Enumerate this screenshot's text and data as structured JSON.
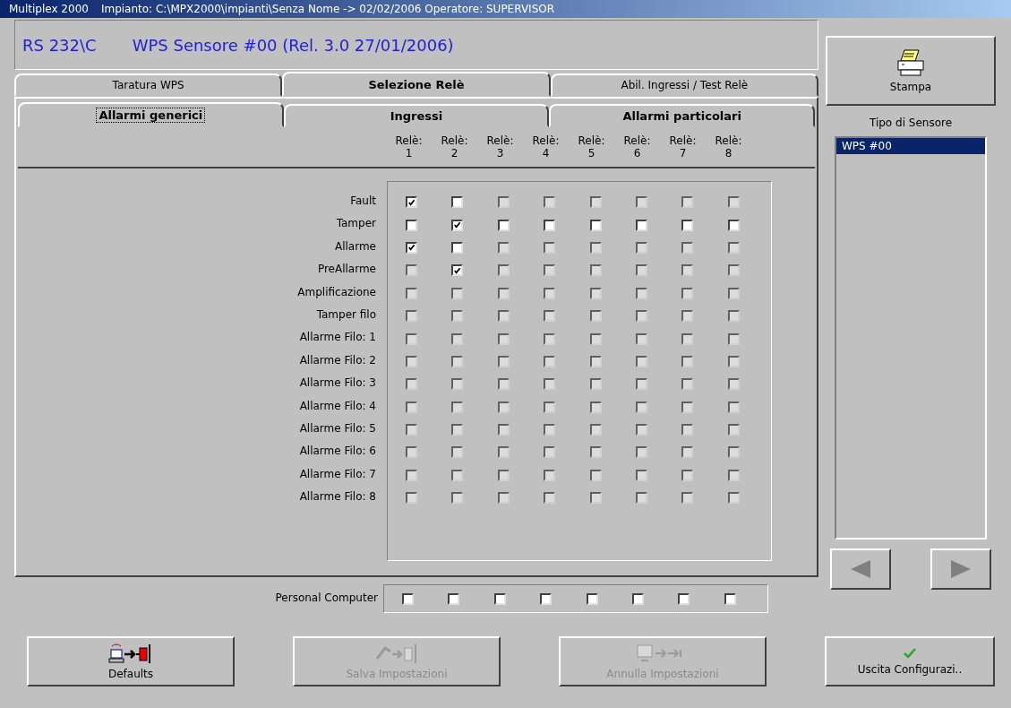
{
  "window": {
    "app": "Multiplex 2000",
    "title": "Impianto: C:\\MPX2000\\impianti\\Senza Nome -> 02/02/2006 Operatore: SUPERVISOR"
  },
  "header": {
    "port": "RS 232\\C",
    "device": "WPS  Sensore #00  (Rel. 3.0 27/01/2006)"
  },
  "tabs": [
    {
      "label": "Taratura WPS",
      "selected": false
    },
    {
      "label": "Selezione Relè",
      "selected": true
    },
    {
      "label": "Abil. Ingressi / Test Relè",
      "selected": false
    }
  ],
  "subtabs": [
    {
      "label": "Allarmi generici",
      "selected": true
    },
    {
      "label": "Ingressi",
      "selected": false
    },
    {
      "label": "Allarmi particolari",
      "selected": false
    }
  ],
  "relays": [
    {
      "label": "Relè:",
      "number": "1"
    },
    {
      "label": "Relè:",
      "number": "2"
    },
    {
      "label": "Relè:",
      "number": "3"
    },
    {
      "label": "Relè:",
      "number": "4"
    },
    {
      "label": "Relè:",
      "number": "5"
    },
    {
      "label": "Relè:",
      "number": "6"
    },
    {
      "label": "Relè:",
      "number": "7"
    },
    {
      "label": "Relè:",
      "number": "8"
    }
  ],
  "rows": [
    {
      "label": "Fault",
      "checked": [
        true,
        false,
        false,
        false,
        false,
        false,
        false,
        false
      ],
      "disabled": [
        false,
        false,
        true,
        true,
        true,
        true,
        true,
        true
      ]
    },
    {
      "label": "Tamper",
      "checked": [
        false,
        true,
        false,
        false,
        false,
        false,
        false,
        false
      ],
      "disabled": [
        false,
        false,
        false,
        false,
        false,
        false,
        false,
        false
      ]
    },
    {
      "label": "Allarme",
      "checked": [
        true,
        false,
        false,
        false,
        false,
        false,
        false,
        false
      ],
      "disabled": [
        false,
        false,
        true,
        true,
        true,
        true,
        true,
        true
      ]
    },
    {
      "label": "PreAllarme",
      "checked": [
        false,
        true,
        false,
        false,
        false,
        false,
        false,
        false
      ],
      "disabled": [
        true,
        false,
        true,
        true,
        true,
        true,
        true,
        true
      ]
    },
    {
      "label": "Amplificazione",
      "checked": [
        false,
        false,
        false,
        false,
        false,
        false,
        false,
        false
      ],
      "disabled": [
        true,
        true,
        true,
        true,
        true,
        true,
        true,
        true
      ]
    },
    {
      "label": "Tamper filo",
      "checked": [
        false,
        false,
        false,
        false,
        false,
        false,
        false,
        false
      ],
      "disabled": [
        true,
        true,
        true,
        true,
        true,
        true,
        true,
        true
      ]
    },
    {
      "label": "Allarme Filo: 1",
      "checked": [
        false,
        false,
        false,
        false,
        false,
        false,
        false,
        false
      ],
      "disabled": [
        true,
        true,
        true,
        true,
        true,
        true,
        true,
        true
      ]
    },
    {
      "label": "Allarme Filo: 2",
      "checked": [
        false,
        false,
        false,
        false,
        false,
        false,
        false,
        false
      ],
      "disabled": [
        true,
        true,
        true,
        true,
        true,
        true,
        true,
        true
      ]
    },
    {
      "label": "Allarme Filo: 3",
      "checked": [
        false,
        false,
        false,
        false,
        false,
        false,
        false,
        false
      ],
      "disabled": [
        true,
        true,
        true,
        true,
        true,
        true,
        true,
        true
      ]
    },
    {
      "label": "Allarme Filo: 4",
      "checked": [
        false,
        false,
        false,
        false,
        false,
        false,
        false,
        false
      ],
      "disabled": [
        true,
        true,
        true,
        true,
        true,
        true,
        true,
        true
      ]
    },
    {
      "label": "Allarme Filo: 5",
      "checked": [
        false,
        false,
        false,
        false,
        false,
        false,
        false,
        false
      ],
      "disabled": [
        true,
        true,
        true,
        true,
        true,
        true,
        true,
        true
      ]
    },
    {
      "label": "Allarme Filo: 6",
      "checked": [
        false,
        false,
        false,
        false,
        false,
        false,
        false,
        false
      ],
      "disabled": [
        true,
        true,
        true,
        true,
        true,
        true,
        true,
        true
      ]
    },
    {
      "label": "Allarme Filo: 7",
      "checked": [
        false,
        false,
        false,
        false,
        false,
        false,
        false,
        false
      ],
      "disabled": [
        true,
        true,
        true,
        true,
        true,
        true,
        true,
        true
      ]
    },
    {
      "label": "Allarme Filo: 8",
      "checked": [
        false,
        false,
        false,
        false,
        false,
        false,
        false,
        false
      ],
      "disabled": [
        true,
        true,
        true,
        true,
        true,
        true,
        true,
        true
      ]
    }
  ],
  "pc_row": {
    "label": "Personal Computer",
    "checked": [
      false,
      false,
      false,
      false,
      false,
      false,
      false,
      false
    ]
  },
  "print_button": {
    "label": "Stampa"
  },
  "sensor_type": {
    "label": "Tipo di Sensore",
    "items": [
      {
        "label": "WPS  #00",
        "selected": true
      }
    ]
  },
  "buttons": [
    {
      "kind": "defaults",
      "label": "Defaults",
      "disabled": false
    },
    {
      "kind": "save",
      "label": "Salva Impostazioni",
      "disabled": true
    },
    {
      "kind": "cancel",
      "label": "Annulla Impostazioni",
      "disabled": true
    },
    {
      "kind": "exit",
      "label": "Uscita Configurazi..",
      "disabled": false
    }
  ]
}
